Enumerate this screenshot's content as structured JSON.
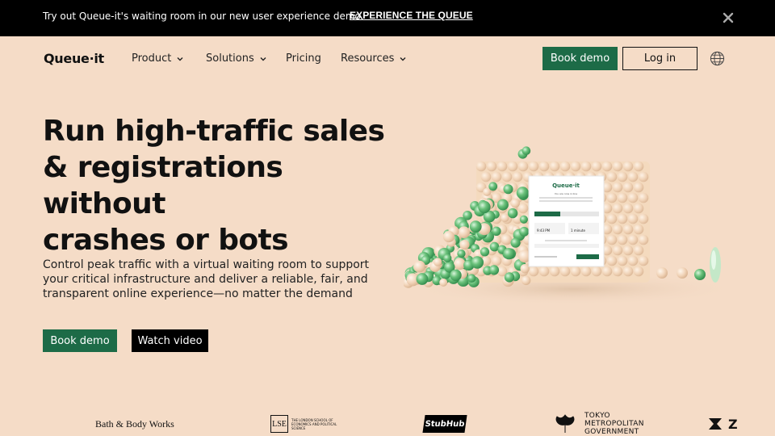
{
  "banner": {
    "text": "Try out Queue-it's waiting room in our new user experience demo.",
    "link": "EXPERIENCE THE QUEUE",
    "close_icon": "close-icon"
  },
  "nav": {
    "logo": "Queue·it",
    "items": [
      {
        "label": "Product",
        "has_dropdown": true
      },
      {
        "label": "Solutions",
        "has_dropdown": true
      },
      {
        "label": "Pricing",
        "has_dropdown": false
      },
      {
        "label": "Resources",
        "has_dropdown": true
      }
    ],
    "book_demo": "Book demo",
    "login": "Log in",
    "globe_icon": "globe-icon"
  },
  "hero": {
    "title_lines": [
      "Run high-traffic sales",
      "& registrations without",
      "crashes or bots"
    ],
    "subtitle": "Control peak traffic with a virtual waiting room to support your critical infrastructure and deliver a reliable, fair, and transparent online experience—no matter the demand",
    "book_demo": "Book demo",
    "watch_video": "Watch video"
  },
  "queue_card": {
    "logo": "Queue·it",
    "line1": "You are now in line",
    "value1": "9:43 PM",
    "value2": "1 minute"
  },
  "customer_logos": {
    "bbw": "Bath & Body Works",
    "lse_mark": "LSE",
    "lse_text": "THE LONDON SCHOOL OF ECONOMICS AND POLITICAL SCIENCE",
    "stubhub": "StubHub",
    "tokyo": [
      "TOKYO",
      "METROPOLITAN",
      "GOVERNMENT"
    ],
    "z_letter": "Z"
  },
  "colors": {
    "background": "#f5dcc7",
    "brand_green": "#1d6b47",
    "banner": "#000000"
  }
}
